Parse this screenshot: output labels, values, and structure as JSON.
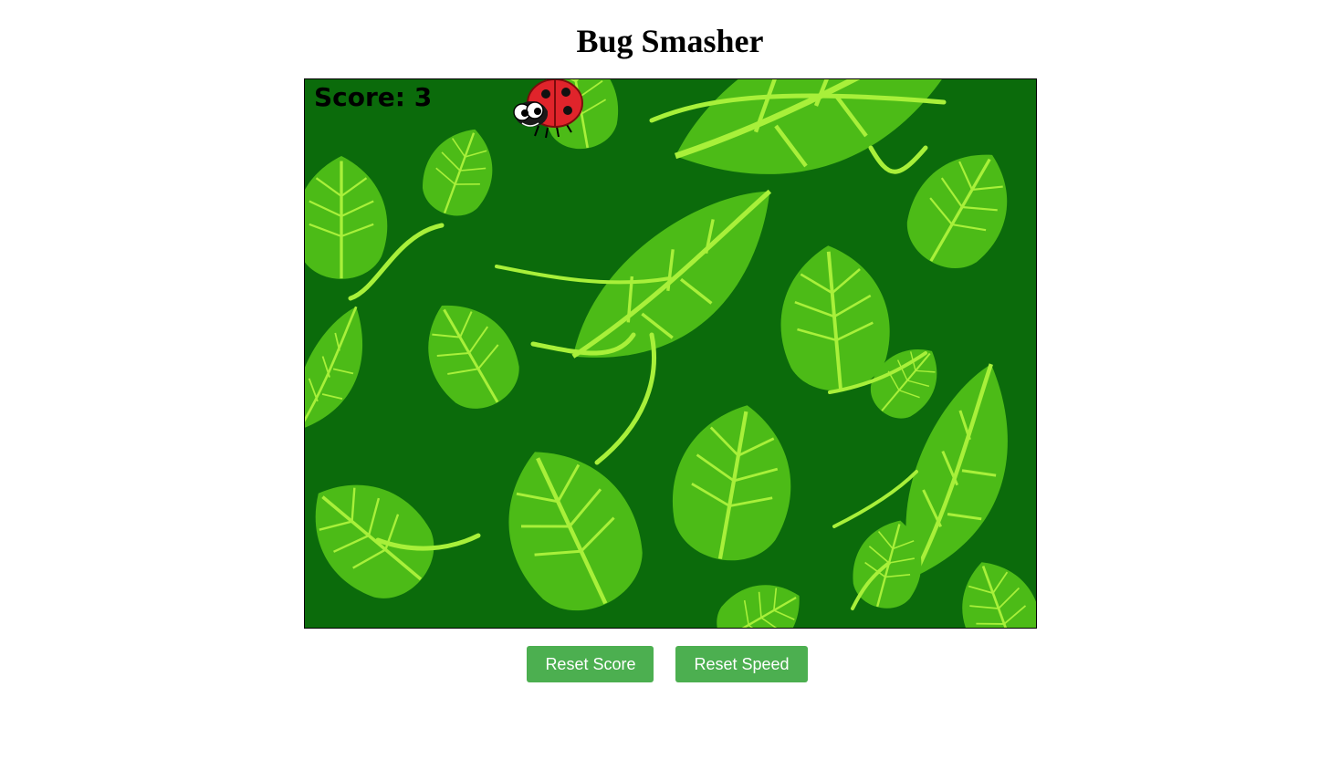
{
  "page": {
    "title": "Bug Smasher"
  },
  "game": {
    "score_text": "Score: 3",
    "score": 3,
    "sprite": "ladybug",
    "background": "tropical-leaves"
  },
  "buttons": {
    "reset_score": "Reset Score",
    "reset_speed": "Reset Speed"
  },
  "colors": {
    "background_dark_green": "#0b6b0b",
    "leaf_green": "#4cbb17",
    "vein_lime": "#a8f03a",
    "button_green": "#4caf50",
    "ladybug_red": "#e0242b"
  }
}
